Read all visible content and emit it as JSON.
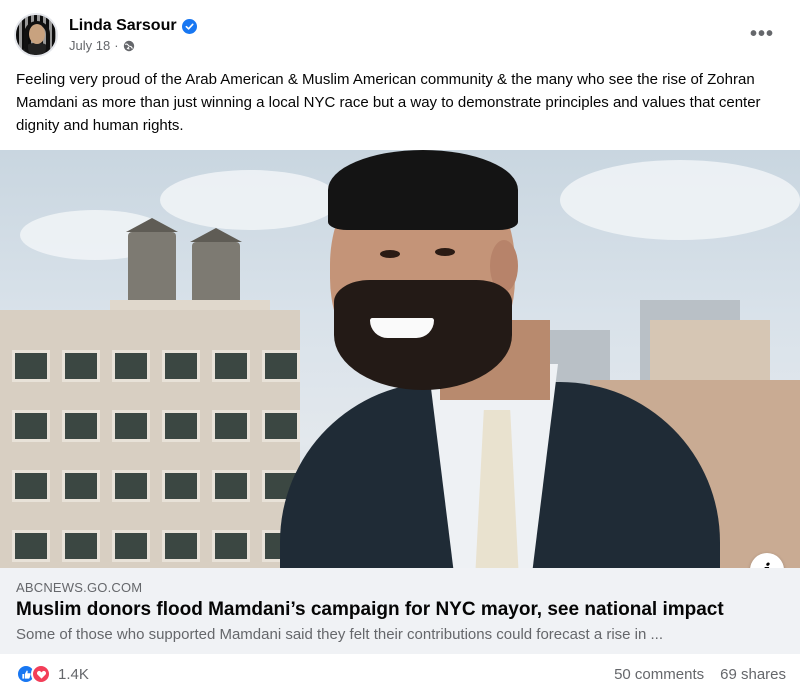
{
  "post": {
    "author": "Linda Sarsour",
    "date": "July 18",
    "separator": "·",
    "text": "Feeling very proud of the Arab American & Muslim American community & the many who see the rise of Zohran Mamdani as more than just winning a local NYC race but a way to demonstrate principles and values that center dignity and human rights.",
    "more_label": "•••"
  },
  "link": {
    "domain": "ABCNEWS.GO.COM",
    "title": "Muslim donors flood Mamdani’s campaign for NYC mayor, see national impact",
    "description": "Some of those who supported Mamdani said they felt their contributions could forecast a rise in ...",
    "info_label": "i"
  },
  "footer": {
    "reaction_count": "1.4K",
    "comments": "50 comments",
    "shares": "69 shares"
  },
  "icons": {
    "verified": "verified-badge-icon",
    "privacy": "globe-icon",
    "like": "like-icon",
    "love": "love-icon",
    "more": "more-options-icon",
    "info": "info-icon"
  },
  "colors": {
    "brand_blue": "#1877f2",
    "love_red": "#f33e58",
    "secondary_text": "#65676b",
    "link_bar_bg": "#f0f2f5"
  }
}
